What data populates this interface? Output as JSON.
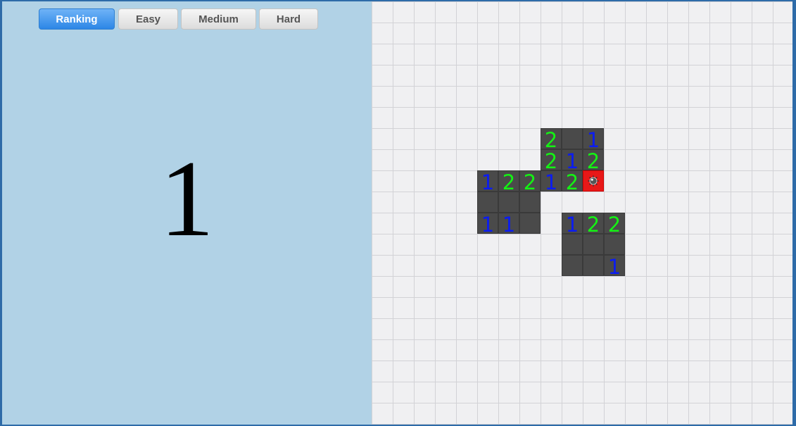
{
  "tabs": [
    {
      "label": "Ranking",
      "active": true
    },
    {
      "label": "Easy",
      "active": false
    },
    {
      "label": "Medium",
      "active": false
    },
    {
      "label": "Hard",
      "active": false
    }
  ],
  "display_value": "1",
  "colors": {
    "number_1": "#0b1cf2",
    "number_2": "#14f214",
    "revealed_cell": "#4a4a4a",
    "exploded_cell": "#e81818",
    "panel_background": "#b1d2e6"
  },
  "board": {
    "revealed_cells": [
      {
        "row": 6,
        "col": 8,
        "value": "2"
      },
      {
        "row": 6,
        "col": 9,
        "value": ""
      },
      {
        "row": 6,
        "col": 10,
        "value": "1"
      },
      {
        "row": 7,
        "col": 8,
        "value": "2"
      },
      {
        "row": 7,
        "col": 9,
        "value": "1"
      },
      {
        "row": 7,
        "col": 10,
        "value": "2"
      },
      {
        "row": 8,
        "col": 5,
        "value": "1"
      },
      {
        "row": 8,
        "col": 6,
        "value": "2"
      },
      {
        "row": 8,
        "col": 7,
        "value": "2"
      },
      {
        "row": 8,
        "col": 8,
        "value": "1"
      },
      {
        "row": 8,
        "col": 9,
        "value": "2"
      },
      {
        "row": 8,
        "col": 10,
        "value": "mine"
      },
      {
        "row": 9,
        "col": 5,
        "value": ""
      },
      {
        "row": 9,
        "col": 6,
        "value": ""
      },
      {
        "row": 9,
        "col": 7,
        "value": ""
      },
      {
        "row": 10,
        "col": 5,
        "value": "1"
      },
      {
        "row": 10,
        "col": 6,
        "value": "1"
      },
      {
        "row": 10,
        "col": 7,
        "value": ""
      },
      {
        "row": 10,
        "col": 9,
        "value": "1"
      },
      {
        "row": 10,
        "col": 10,
        "value": "2"
      },
      {
        "row": 10,
        "col": 11,
        "value": "2"
      },
      {
        "row": 11,
        "col": 9,
        "value": ""
      },
      {
        "row": 11,
        "col": 10,
        "value": ""
      },
      {
        "row": 11,
        "col": 11,
        "value": ""
      },
      {
        "row": 12,
        "col": 9,
        "value": ""
      },
      {
        "row": 12,
        "col": 10,
        "value": ""
      },
      {
        "row": 12,
        "col": 11,
        "value": "1"
      }
    ]
  }
}
